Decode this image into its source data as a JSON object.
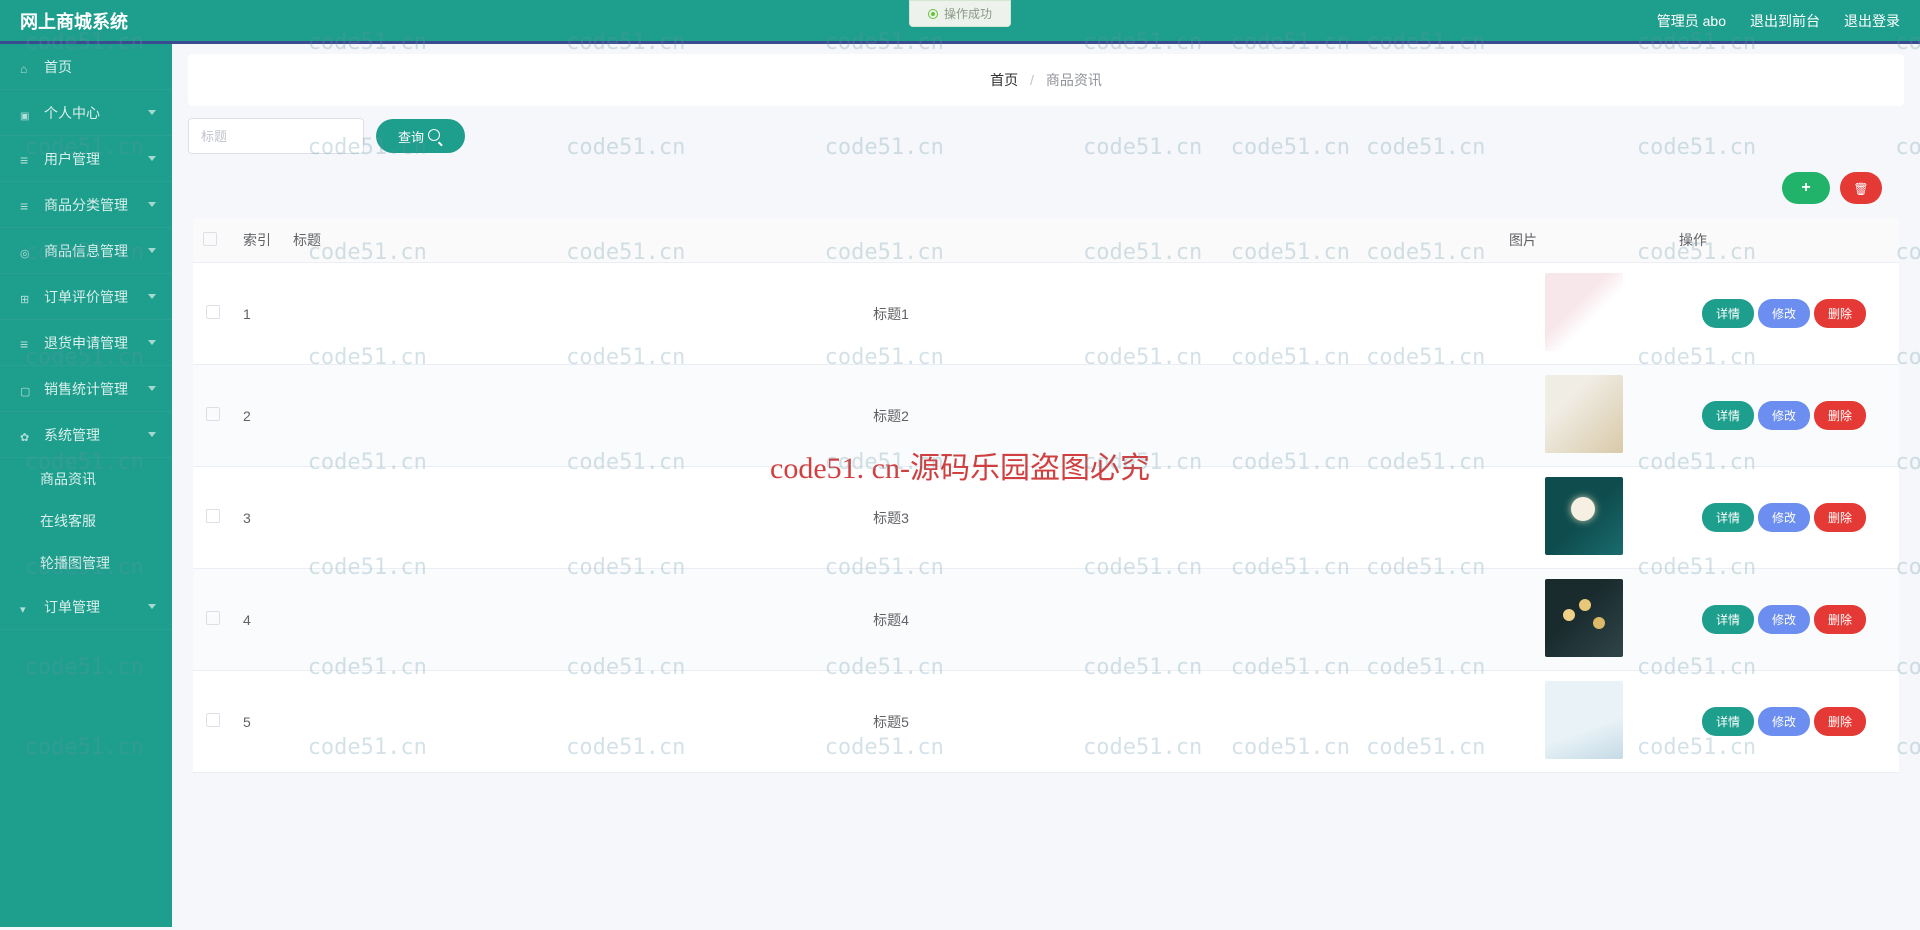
{
  "header": {
    "system_title": "网上商城系统",
    "admin_label": "管理员 abo",
    "to_front": "退出到前台",
    "logout": "退出登录"
  },
  "notification": "操作成功",
  "sidebar": [
    {
      "label": "首页",
      "icon": "icon-home",
      "sub": false
    },
    {
      "label": "个人中心",
      "icon": "icon-user",
      "sub": true
    },
    {
      "label": "用户管理",
      "icon": "icon-bars",
      "sub": true
    },
    {
      "label": "商品分类管理",
      "icon": "icon-bars",
      "sub": true
    },
    {
      "label": "商品信息管理",
      "icon": "icon-target",
      "sub": true
    },
    {
      "label": "订单评价管理",
      "icon": "icon-grid",
      "sub": true
    },
    {
      "label": "退货申请管理",
      "icon": "icon-bars",
      "sub": true
    },
    {
      "label": "销售统计管理",
      "icon": "icon-box",
      "sub": true
    },
    {
      "label": "系统管理",
      "icon": "icon-gear",
      "sub": true
    }
  ],
  "submenu": [
    "商品资讯",
    "在线客服",
    "轮播图管理"
  ],
  "sidebar_tail": {
    "label": "订单管理",
    "icon": "icon-drop",
    "sub": true
  },
  "breadcrumb": {
    "home": "首页",
    "current": "商品资讯"
  },
  "search": {
    "placeholder": "标题",
    "button": "查询"
  },
  "table": {
    "headers": {
      "index": "索引",
      "title": "标题",
      "image": "图片",
      "ops": "操作"
    },
    "rows": [
      {
        "index": "1",
        "title": "标题1",
        "thumb": "thumb-1"
      },
      {
        "index": "2",
        "title": "标题2",
        "thumb": "thumb-2"
      },
      {
        "index": "3",
        "title": "标题3",
        "thumb": "thumb-3"
      },
      {
        "index": "4",
        "title": "标题4",
        "thumb": "thumb-4"
      },
      {
        "index": "5",
        "title": "标题5",
        "thumb": "thumb-5"
      }
    ],
    "ops": {
      "detail": "详情",
      "edit": "修改",
      "delete": "删除"
    }
  },
  "watermark": {
    "small": "code51.cn",
    "center": "code51. cn-源码乐园盗图必究"
  }
}
